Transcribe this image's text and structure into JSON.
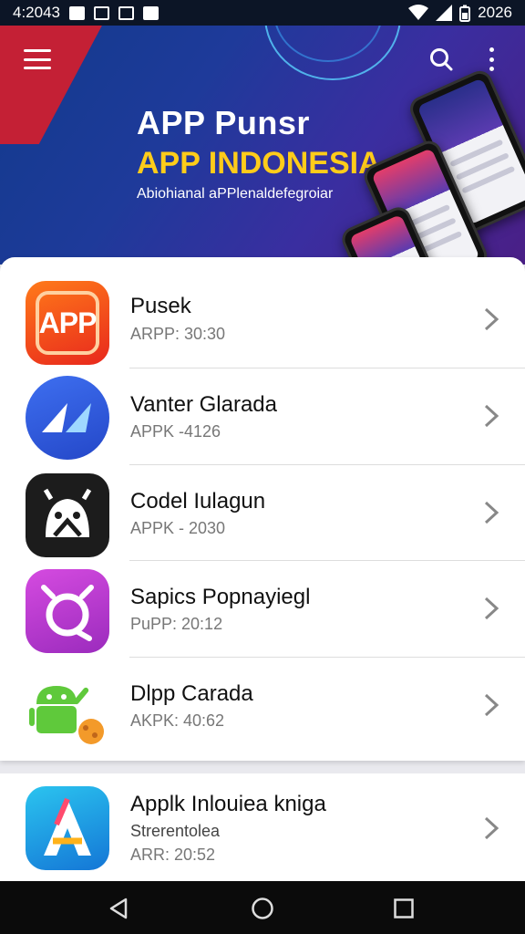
{
  "status_bar": {
    "time": "4:2043",
    "battery_text": "2026",
    "left_icons": [
      "notification-a-icon",
      "notification-s-icon",
      "notification-box-icon",
      "notification-tv-icon"
    ],
    "right_icons": [
      "wifi-icon",
      "signal-icon",
      "battery-icon"
    ]
  },
  "header": {
    "title": "APP Punsr",
    "subtitle": "APP INDONESIA",
    "tagline": "Abiohianal aPPlenaldefegroiar",
    "colors": {
      "title": "#ffffff",
      "subtitle": "#ffcc1a",
      "background": "#1e3a9a"
    }
  },
  "apps": [
    {
      "name": "Pusek",
      "subtitle": "ARPP: 30:30",
      "icon": "app-logo-icon",
      "icon_text": "APP"
    },
    {
      "name": "Vanter Glarada",
      "subtitle": "APPK -4126",
      "icon": "arrow-logo-icon"
    },
    {
      "name": "Codel Iulagun",
      "subtitle": "APPK - 2030",
      "icon": "robot-face-icon"
    },
    {
      "name": "Sapics Popnayiegl",
      "subtitle": "PuPP: 20:12",
      "icon": "magenta-creature-icon"
    },
    {
      "name": "Dlpp Carada",
      "subtitle": "AKPK: 40:62",
      "icon": "android-robot-icon"
    }
  ],
  "featured_app": {
    "name": "Applk Inlouiea kniga",
    "subtitle": "Strerentolea",
    "meta": "ARR: 20:52",
    "icon": "a-logo-icon"
  },
  "nav": {
    "buttons": [
      "back-button",
      "home-button",
      "recents-button"
    ]
  }
}
